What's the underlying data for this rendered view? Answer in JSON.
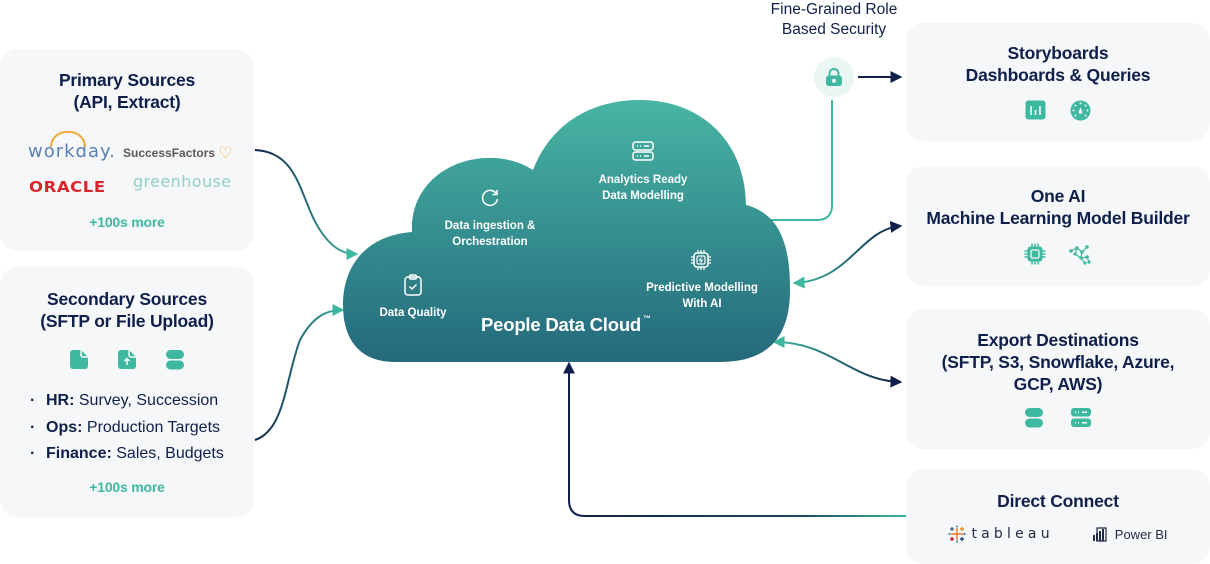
{
  "colors": {
    "navy": "#0f1f4b",
    "teal": "#3fb8a0",
    "cloud_top": "#47b5a3",
    "cloud_bottom": "#24707f",
    "card_bg": "#f6f7f8"
  },
  "primary_sources": {
    "title_line1": "Primary Sources",
    "title_line2": "(API, Extract)",
    "logos": [
      "workday.",
      "SuccessFactors",
      "ORACLE",
      "greenhouse"
    ],
    "more": "+100s more"
  },
  "secondary_sources": {
    "title_line1": "Secondary Sources",
    "title_line2": "(SFTP or File Upload)",
    "icons": [
      "file-icon",
      "file-upload-icon",
      "database-icon"
    ],
    "bullets": [
      {
        "label": "HR:",
        "text": " Survey, Succession"
      },
      {
        "label": "Ops:",
        "text": " Production Targets"
      },
      {
        "label": "Finance:",
        "text": " Sales, Budgets"
      }
    ],
    "more": "+100s more"
  },
  "cloud": {
    "title": "People Data Cloud",
    "trademark": "™",
    "features": [
      {
        "icon": "refresh-icon",
        "line1": "Data ingestion &",
        "line2": "Orchestration"
      },
      {
        "icon": "server-icon",
        "line1": "Analytics Ready",
        "line2": "Data Modelling"
      },
      {
        "icon": "clipboard-check-icon",
        "line1": "Data Quality",
        "line2": ""
      },
      {
        "icon": "ai-chip-icon",
        "line1": "Predictive Modelling",
        "line2": "With AI"
      }
    ]
  },
  "security": {
    "line1": "Fine-Grained Role",
    "line2": "Based Security",
    "icon": "lock-icon"
  },
  "destinations": {
    "storyboards": {
      "line1": "Storyboards",
      "line2": "Dashboards & Queries",
      "icons": [
        "bar-chart-icon",
        "dashboard-gauge-icon"
      ]
    },
    "one_ai": {
      "line1": "One AI",
      "line2": "Machine Learning Model Builder",
      "icons": [
        "chip-icon",
        "network-graph-icon"
      ]
    },
    "export": {
      "line1": "Export Destinations",
      "line2": "(SFTP, S3, Snowflake, Azure,",
      "line3": "GCP, AWS)",
      "icons": [
        "database-icon",
        "server-icon"
      ]
    },
    "direct_connect": {
      "title": "Direct Connect",
      "brands": [
        "tableau",
        "Power BI"
      ]
    }
  }
}
